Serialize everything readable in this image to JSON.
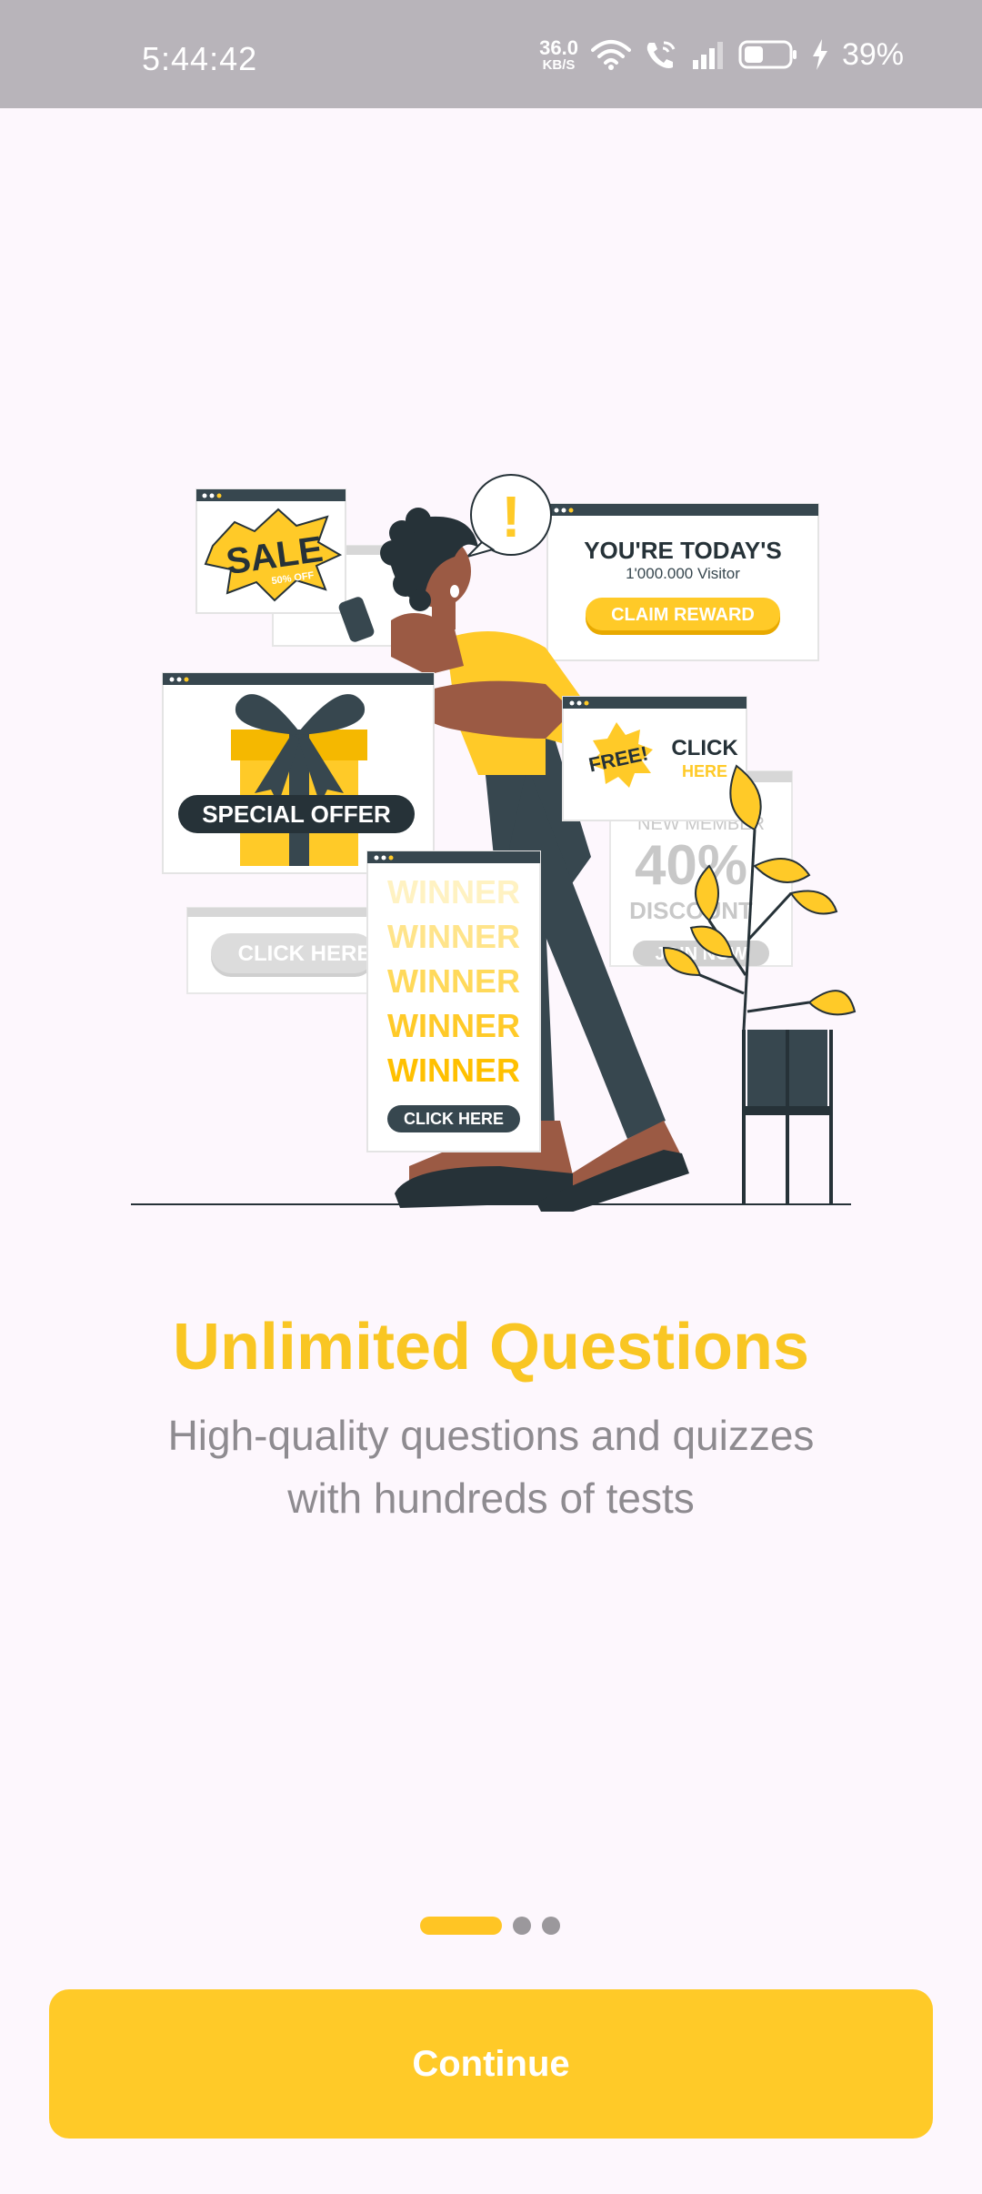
{
  "status_bar": {
    "time": "5:44:42",
    "net_speed_value": "36.0",
    "net_speed_unit": "KB/S",
    "battery_percent": "39%",
    "icons": [
      "wifi-icon",
      "wifi-calling-icon",
      "signal-icon",
      "battery-icon",
      "charging-icon"
    ]
  },
  "illustration": {
    "sale_text": "SALE",
    "sale_sub": "50% OFF",
    "today_title": "YOU'RE TODAY'S",
    "today_visitor": "1'000.000 Visitor",
    "claim_reward": "CLAIM REWARD",
    "special_offer": "SPECIAL OFFER",
    "free_text": "FREE!",
    "click_text": "CLICK",
    "here_text": "HERE",
    "new_member": "NEW MEMBER",
    "discount_value": "40%",
    "discount_text": "DISCOUNT",
    "join_now": "JOIN NOW",
    "winner_word": "WINNER",
    "click_here": "CLICK HERE",
    "click_here_gray": "CLICK HERE",
    "exclaim": "!"
  },
  "onboarding": {
    "title": "Unlimited Questions",
    "subtitle_line1": "High-quality questions and quizzes",
    "subtitle_line2": "with hundreds of tests"
  },
  "continue_label": "Continue",
  "colors": {
    "accent": "#FFCA28",
    "title": "#F9C623",
    "subtitle": "#8E8B90",
    "background": "#FDF7FD",
    "status_bar": "#B8B4BA",
    "dark": "#37474F"
  }
}
